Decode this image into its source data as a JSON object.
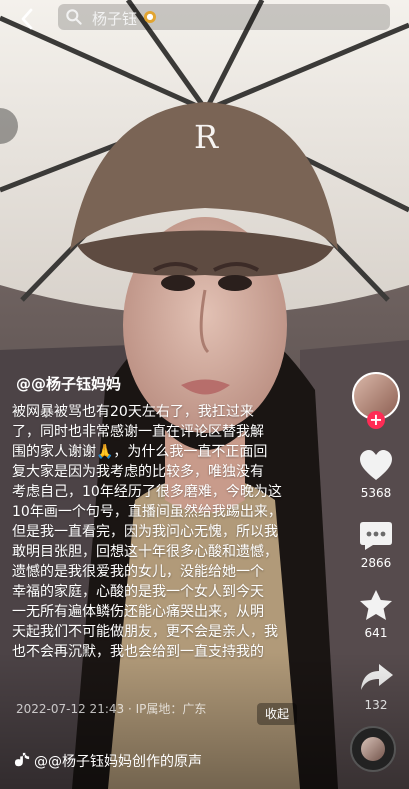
{
  "search": {
    "query": "杨子钰"
  },
  "author": {
    "handle": "@@杨子钰妈妈"
  },
  "caption": {
    "lines": [
      "被网暴被骂也有20天左右了，我扛过来",
      "了，同时也非常感谢一直在评论区替我解",
      "围的家人谢谢🙏，为什么我一直不正面回",
      "复大家是因为我考虑的比较多，唯独没有",
      "考虑自己，10年经历了很多磨难，今晚为这",
      "10年画一个句号，直播间虽然给我踢出来，",
      "但是我一直看完，因为我问心无愧，所以我",
      "敢明目张胆，回想这十年很多心酸和遗憾，",
      "遗憾的是我很爱我的女儿，没能给她一个",
      "幸福的家庭，心酸的是我一个女人到今天",
      "一无所有遍体鳞伤还能心痛哭出来，从明",
      "天起我们不可能做朋友，更不会是亲人，我",
      "也不会再沉默，我也会给到一直支持我的"
    ]
  },
  "post": {
    "meta": "2022-07-12 21:43 · IP属地：广东",
    "collapse_label": "收起"
  },
  "actions": {
    "likes": "5368",
    "comments": "2866",
    "favorites": "641",
    "shares": "132"
  },
  "music": {
    "label": "@@杨子钰妈妈创作的原声"
  },
  "colors": {
    "accent": "#fe2c55",
    "badge": "#e2a531"
  },
  "icons": [
    "back-arrow-icon",
    "search-icon",
    "heart-icon",
    "comment-icon",
    "star-icon",
    "share-icon",
    "tiktok-note-icon",
    "music-disc-icon"
  ]
}
